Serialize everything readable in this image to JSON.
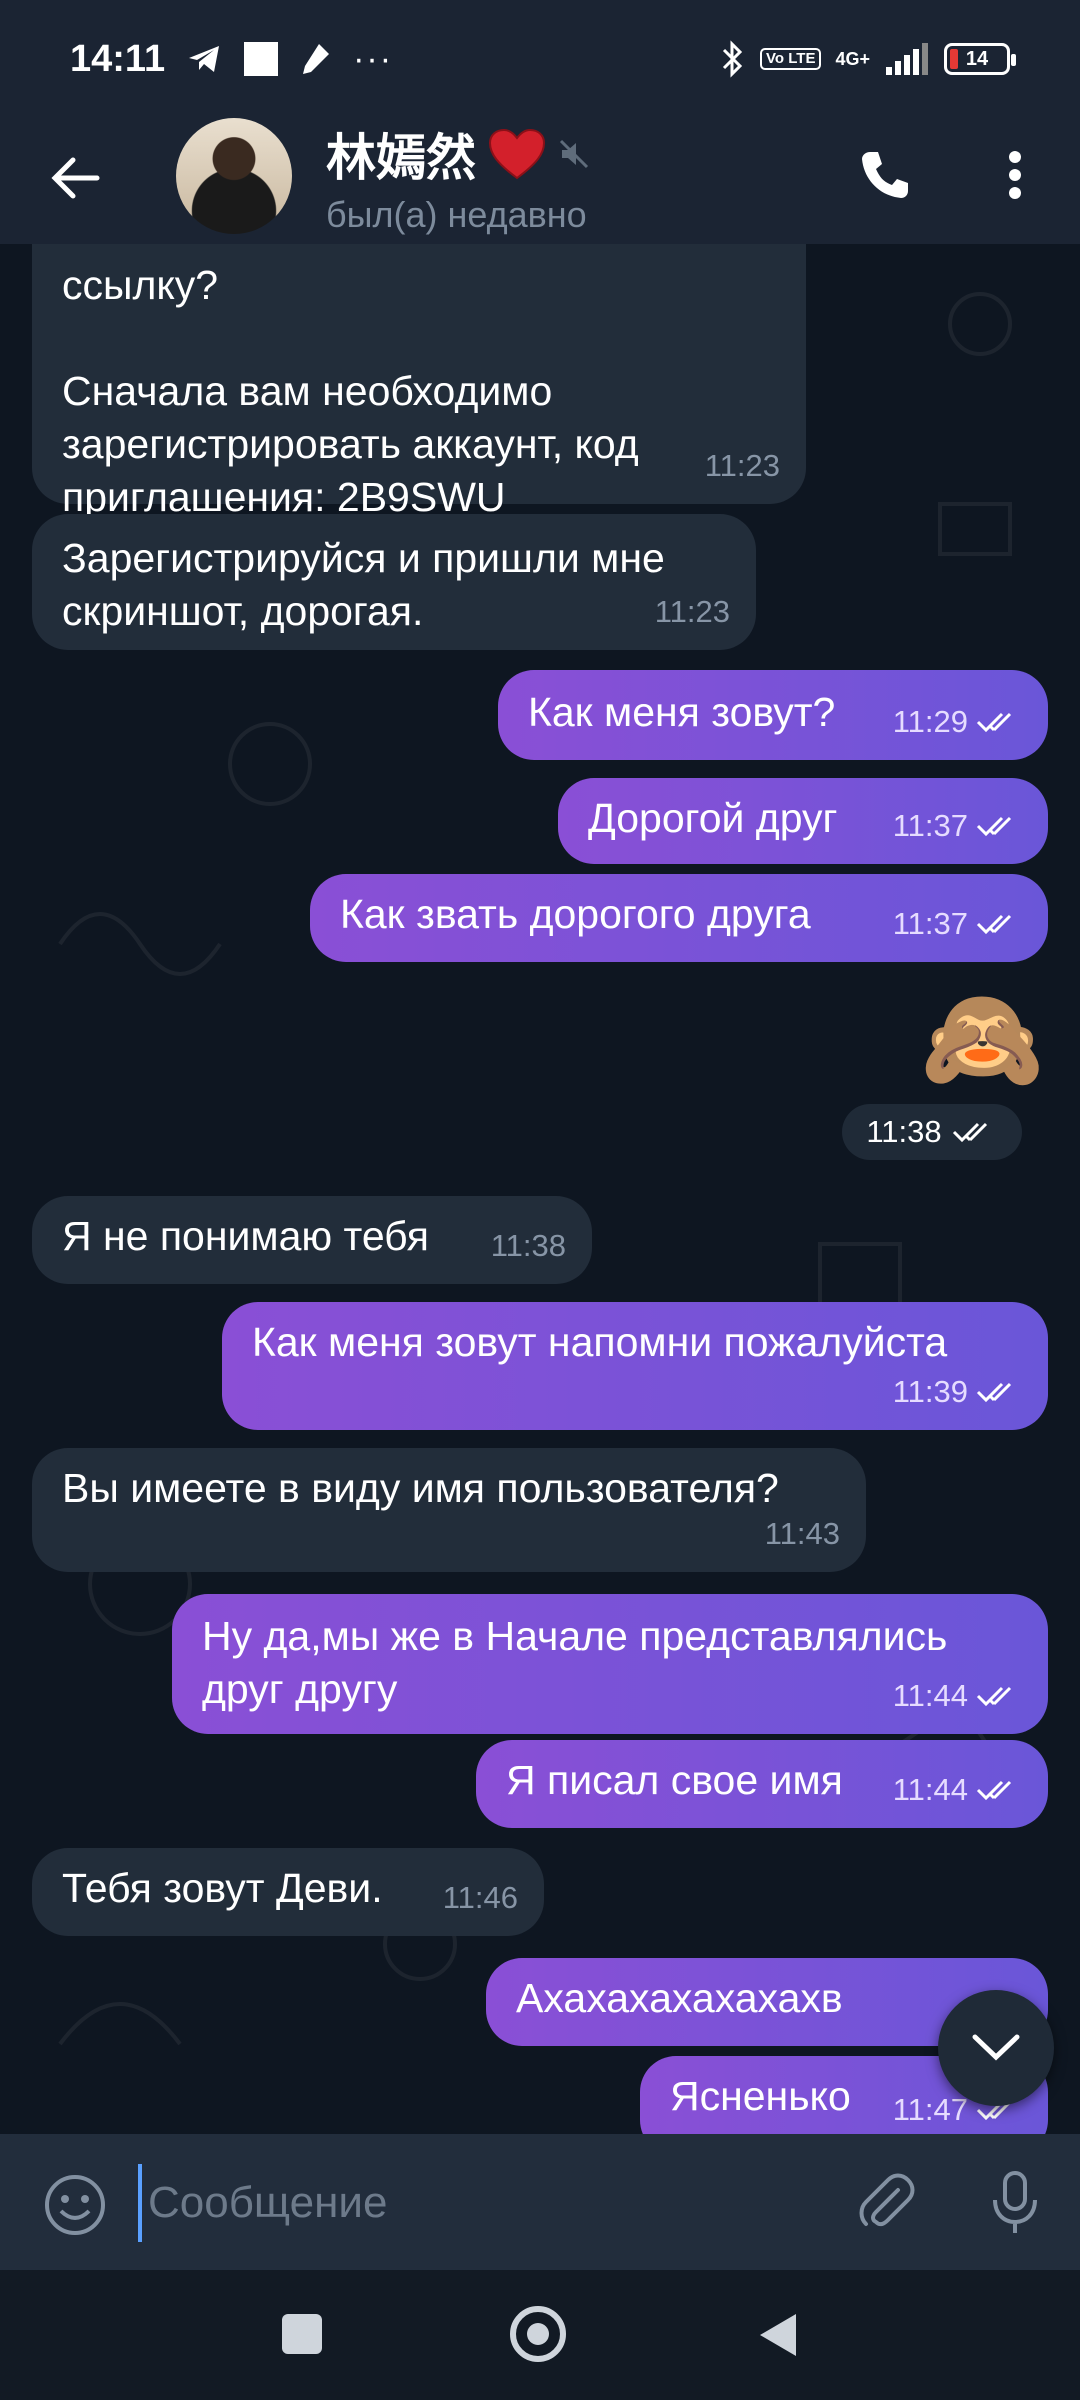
{
  "status_bar": {
    "time": "14:11",
    "network": "4G+",
    "volte": "Vo LTE",
    "battery": "14"
  },
  "header": {
    "title": "林嫣然",
    "status": "был(а) недавно"
  },
  "messages": [
    {
      "dir": "in",
      "text": "ссылку?\n\nСначала вам необходимо зарегистрировать аккаунт, код приглашения: 2B9SWU",
      "time": "11:23"
    },
    {
      "dir": "in",
      "text": "Зарегистрируйся и пришли мне скриншот, дорогая.",
      "time": "11:23"
    },
    {
      "dir": "out",
      "text": "Как меня зовут?",
      "time": "11:29"
    },
    {
      "dir": "out",
      "text": "Дорогой друг",
      "time": "11:37"
    },
    {
      "dir": "out",
      "text": "Как звать дорогого друга",
      "time": "11:37"
    },
    {
      "dir": "out",
      "text": "🙈",
      "time": "11:38"
    },
    {
      "dir": "in",
      "text": "Я не понимаю тебя",
      "time": "11:38"
    },
    {
      "dir": "out",
      "text": "Как меня зовут напомни пожалуйста",
      "time": "11:39"
    },
    {
      "dir": "in",
      "text": "Вы имеете в виду имя пользователя?",
      "time": "11:43"
    },
    {
      "dir": "out",
      "text": "Ну да,мы же в Начале представлялись друг другу",
      "time": "11:44"
    },
    {
      "dir": "out",
      "text": "Я писал свое имя",
      "time": "11:44"
    },
    {
      "dir": "in",
      "text": "Тебя зовут Деви.",
      "time": "11:46"
    },
    {
      "dir": "out",
      "text": "Ахахахахахахахв",
      "time": "11:4"
    },
    {
      "dir": "out",
      "text": "Ясненько",
      "time": "11:47"
    }
  ],
  "input": {
    "placeholder": "Сообщение"
  },
  "colors": {
    "outgoing_bubble_start": "#8a4fd6",
    "outgoing_bubble_end": "#6a56d8",
    "incoming_bubble": "#222d3a",
    "header_bg": "#1b2433",
    "chat_bg": "#0e1621"
  },
  "icons": {
    "back": "arrow-left-icon",
    "heart": "heart-icon",
    "muted": "muted-icon",
    "call": "phone-icon",
    "more": "more-vertical-icon",
    "emoji": "smile-icon",
    "attach": "paperclip-icon",
    "mic": "microphone-icon",
    "read_receipt": "double-check-icon",
    "scroll_down": "chevron-down-icon"
  }
}
